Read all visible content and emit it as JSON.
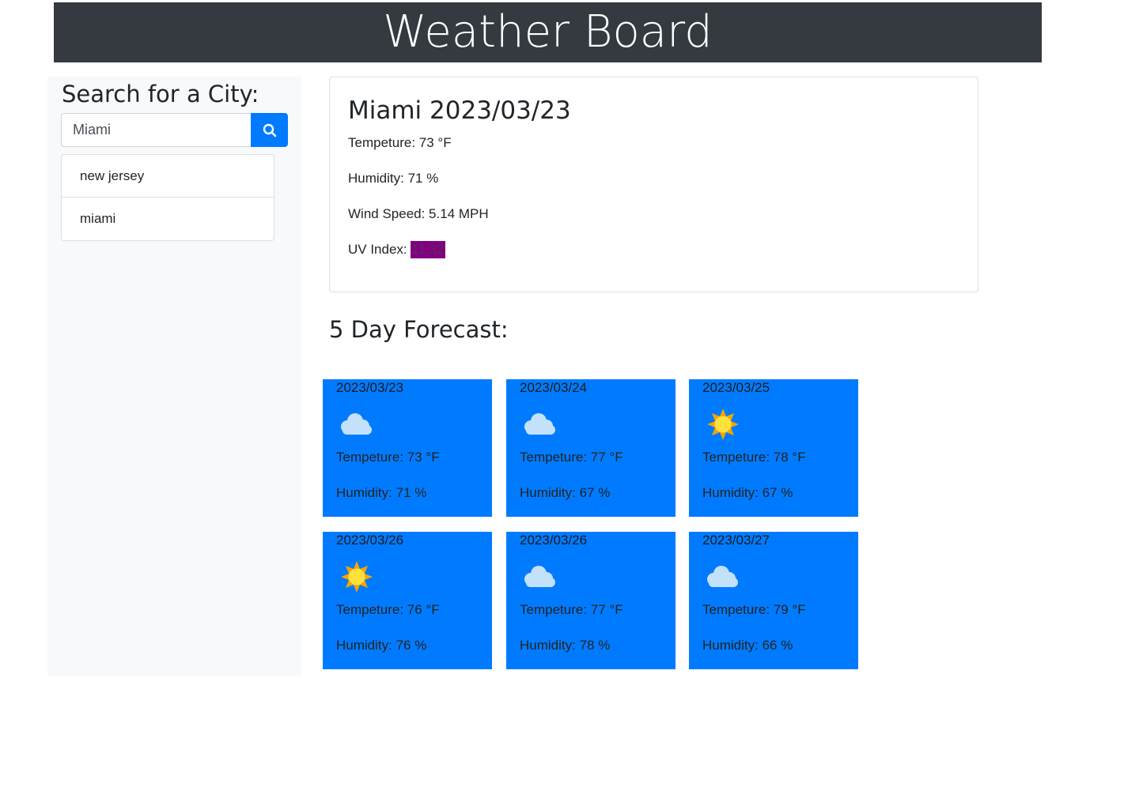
{
  "header": {
    "title": "Weather Board"
  },
  "sidebar": {
    "heading": "Search for a City:",
    "search": {
      "value": "Miami",
      "placeholder": ""
    },
    "search_button_icon": "search-icon",
    "history": [
      "new jersey",
      "miami"
    ]
  },
  "current": {
    "title": "Miami 2023/03/23",
    "temp_label": "Tempeture: 73 °F",
    "humidity_label": "Humidity: 71 %",
    "wind_label": "Wind Speed: 5.14 MPH",
    "uv_prefix": "UV Index: ",
    "uv_value": "11.32",
    "uv_color": "#800080"
  },
  "forecast": {
    "title": "5 Day Forecast:",
    "days": [
      {
        "date": "2023/03/23",
        "icon": "cloud-icon",
        "temp": "Tempeture: 73 °F",
        "humidity": "Humidity: 71 %"
      },
      {
        "date": "2023/03/24",
        "icon": "cloud-icon",
        "temp": "Tempeture: 77 °F",
        "humidity": "Humidity: 67 %"
      },
      {
        "date": "2023/03/25",
        "icon": "sun-icon",
        "temp": "Tempeture: 78 °F",
        "humidity": "Humidity: 67 %"
      },
      {
        "date": "2023/03/26",
        "icon": "sun-icon",
        "temp": "Tempeture: 76 °F",
        "humidity": "Humidity: 76 %"
      },
      {
        "date": "2023/03/26",
        "icon": "cloud-icon",
        "temp": "Tempeture: 77 °F",
        "humidity": "Humidity: 78 %"
      },
      {
        "date": "2023/03/27",
        "icon": "cloud-icon",
        "temp": "Tempeture: 79 °F",
        "humidity": "Humidity: 66 %"
      }
    ]
  },
  "colors": {
    "header_bg": "#343a40",
    "accent": "#007bff",
    "sidebar_bg": "#f8f9fa"
  }
}
